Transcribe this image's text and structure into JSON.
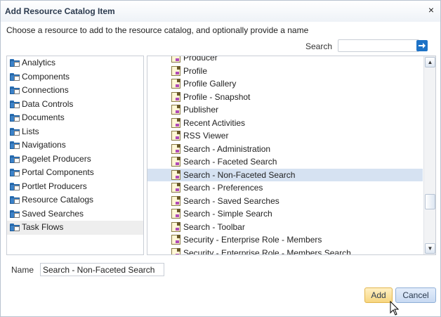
{
  "dialog": {
    "title": "Add Resource Catalog Item",
    "instruction": "Choose a resource to add to the resource catalog, and optionally provide a name",
    "close_icon": "close-icon"
  },
  "search": {
    "label": "Search",
    "value": "",
    "placeholder": "",
    "go_icon": "arrow-right-icon",
    "go_color": "#1d72c6"
  },
  "categories": [
    {
      "label": "Analytics",
      "icon": "folder-icon"
    },
    {
      "label": "Components",
      "icon": "folder-icon"
    },
    {
      "label": "Connections",
      "icon": "folder-icon"
    },
    {
      "label": "Data Controls",
      "icon": "folder-icon"
    },
    {
      "label": "Documents",
      "icon": "folder-icon"
    },
    {
      "label": "Lists",
      "icon": "folder-icon"
    },
    {
      "label": "Navigations",
      "icon": "folder-icon"
    },
    {
      "label": "Pagelet Producers",
      "icon": "folder-icon"
    },
    {
      "label": "Portal Components",
      "icon": "folder-icon"
    },
    {
      "label": "Portlet Producers",
      "icon": "folder-icon"
    },
    {
      "label": "Resource Catalogs",
      "icon": "folder-icon"
    },
    {
      "label": "Saved Searches",
      "icon": "folder-icon"
    },
    {
      "label": "Task Flows",
      "icon": "folder-icon",
      "selected": true
    }
  ],
  "task_flows": [
    {
      "label": "Producer"
    },
    {
      "label": "Profile"
    },
    {
      "label": "Profile Gallery"
    },
    {
      "label": "Profile - Snapshot"
    },
    {
      "label": "Publisher"
    },
    {
      "label": "Recent Activities"
    },
    {
      "label": "RSS Viewer"
    },
    {
      "label": "Search - Administration"
    },
    {
      "label": "Search - Faceted Search"
    },
    {
      "label": "Search - Non-Faceted Search",
      "selected": true
    },
    {
      "label": "Search - Preferences"
    },
    {
      "label": "Search - Saved Searches"
    },
    {
      "label": "Search - Simple Search"
    },
    {
      "label": "Search - Toolbar"
    },
    {
      "label": "Security - Enterprise Role - Members"
    },
    {
      "label": "Security - Enterprise Role - Members Search"
    }
  ],
  "name_field": {
    "label": "Name",
    "value": "Search - Non-Faceted Search"
  },
  "buttons": {
    "add": "Add",
    "cancel": "Cancel"
  },
  "colors": {
    "selected_row": "#d6e2f2",
    "add_button": "#f7d680",
    "cancel_button": "#c8daf2"
  }
}
